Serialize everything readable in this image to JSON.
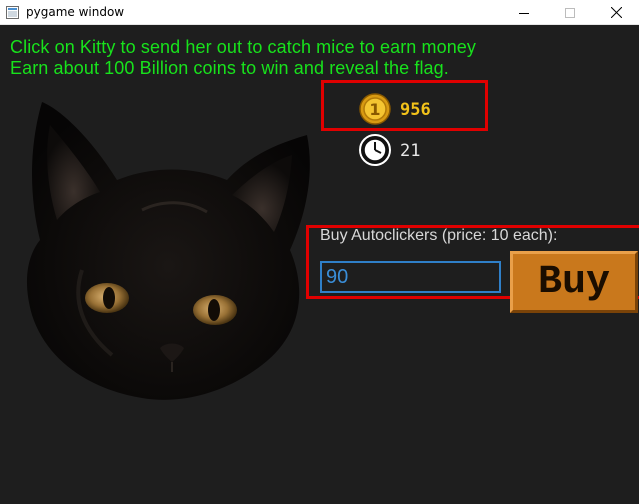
{
  "window": {
    "title": "pygame window",
    "icon": "pygame-icon",
    "controls": [
      "minimize-icon",
      "maximize-icon",
      "close-icon"
    ]
  },
  "game": {
    "instructions": [
      "Click on Kitty to send her out to catch mice to earn money",
      "Earn about 100 Billion coins to win and reveal the flag."
    ],
    "coins": "956",
    "autoclickers": "21",
    "buy_label": "Buy Autoclickers (price: 10 each):",
    "quantity_value": "90",
    "buy_button": "Buy",
    "coin_icon_text": "1"
  },
  "colors": {
    "background": "#1e1e1e",
    "instruction_text": "#18e21c",
    "coin_text": "#f2c21a",
    "highlight": "#e00000",
    "input_border": "#2f7fc8",
    "buy_button": "#c9781c"
  }
}
